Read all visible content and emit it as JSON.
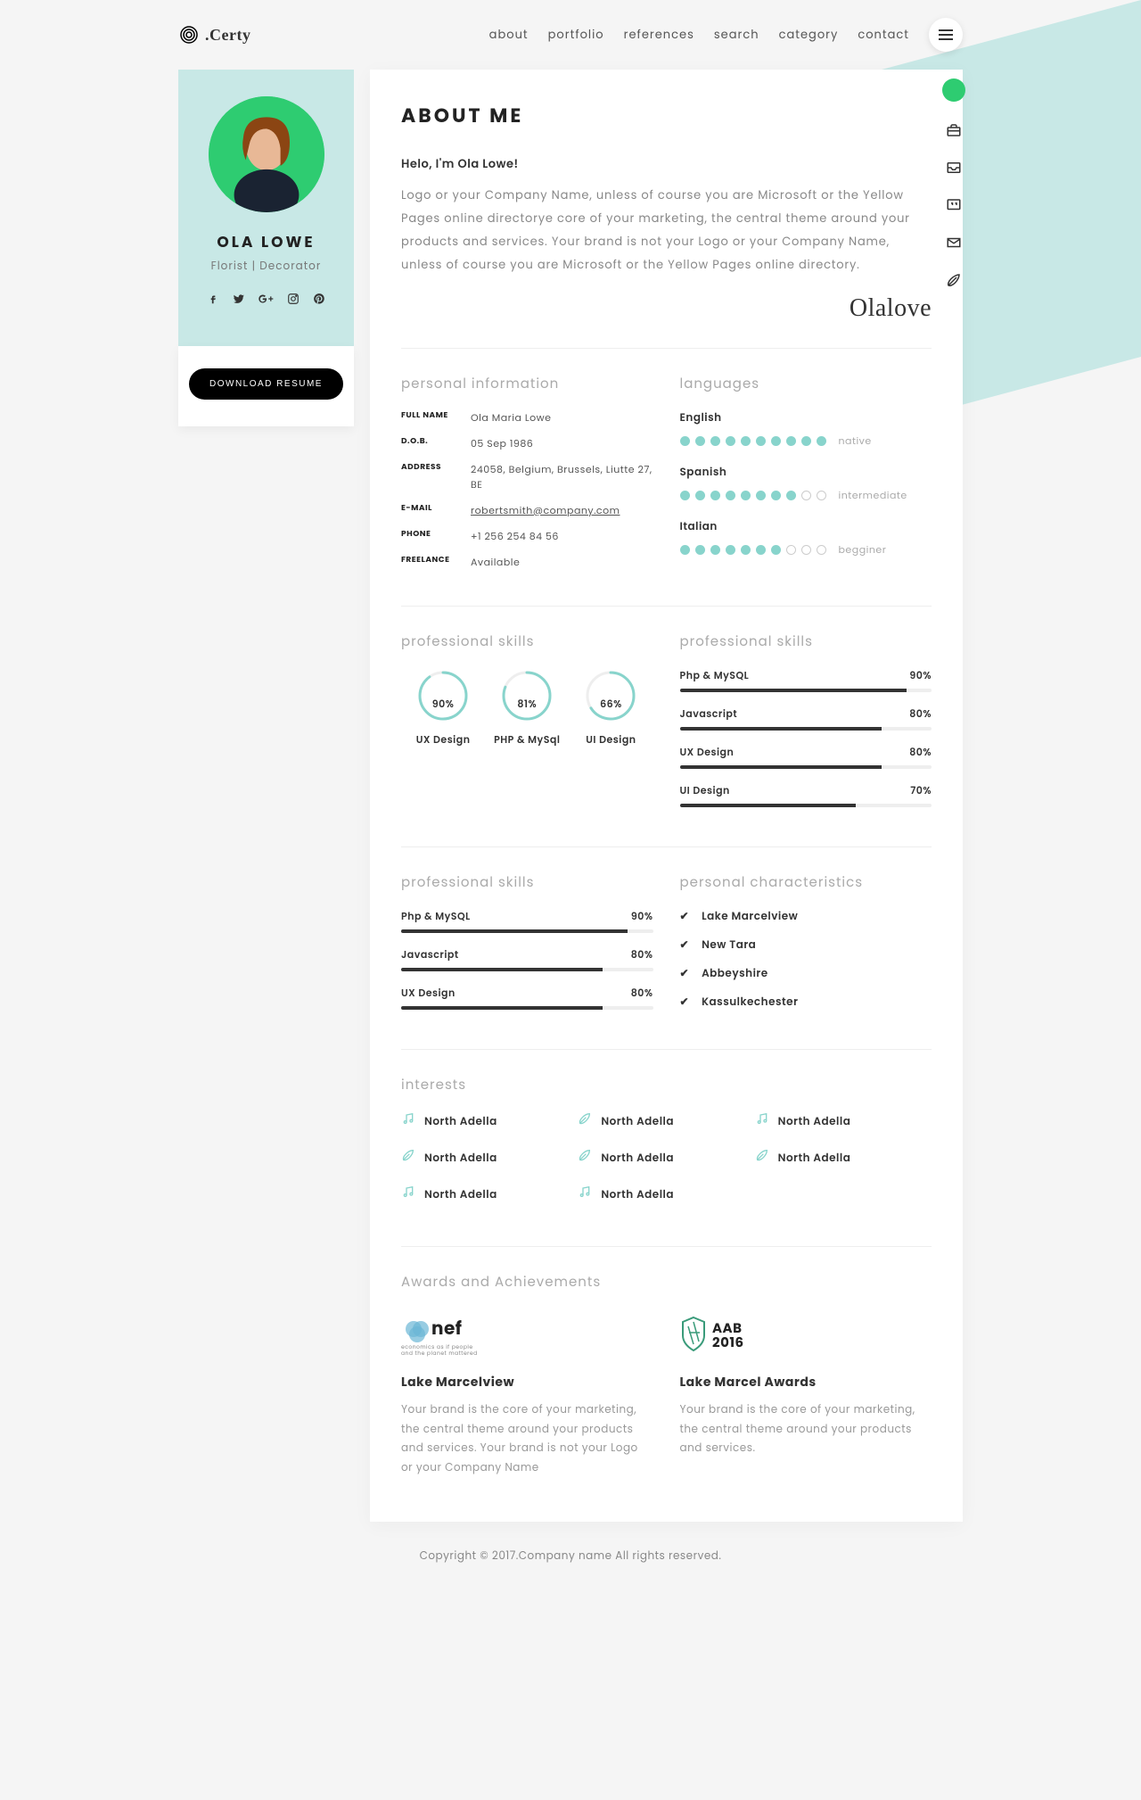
{
  "brand": ".Certy",
  "nav": [
    "about",
    "portfolio",
    "references",
    "search",
    "category",
    "contact"
  ],
  "profile": {
    "name": "OLA LOWE",
    "role": "Florist | Decorator",
    "download": "DOWNLOAD RESUME"
  },
  "about": {
    "heading": "ABOUT ME",
    "hello": "Helo, I'm Ola Lowe!",
    "text": "Logo or your Company Name, unless of course you are Microsoft or the Yellow Pages online directorye core of your marketing, the central theme around your products and services. Your brand is not your Logo or your Company Name, unless of course you are Microsoft or the Yellow Pages online directory.",
    "signature": "Olalove"
  },
  "sections": {
    "personal_info": "personal information",
    "languages": "languages",
    "pro_skills": "professional skills",
    "characteristics": "personal characteristics",
    "interests": "interests",
    "awards": "Awards and Achievements"
  },
  "info": {
    "full_name_l": "FULL NAME",
    "full_name": "Ola Maria Lowe",
    "dob_l": "D.O.B.",
    "dob": "05 Sep 1986",
    "address_l": "ADDRESS",
    "address": "24058, Belgium, Brussels, Liutte 27, BE",
    "email_l": "E-MAIL",
    "email": "robertsmith@company.com",
    "phone_l": "PHONE",
    "phone": "+1 256 254 84 56",
    "freelance_l": "FREELANCE",
    "freelance": "Available"
  },
  "languages": [
    {
      "name": "English",
      "level": "native",
      "filled": 10
    },
    {
      "name": "Spanish",
      "level": "intermediate",
      "filled": 8
    },
    {
      "name": "Italian",
      "level": "begginer",
      "filled": 7
    }
  ],
  "circle_skills": [
    {
      "label": "UX Design",
      "pct": 90
    },
    {
      "label": "PHP & MySql",
      "pct": 81
    },
    {
      "label": "UI Design",
      "pct": 66
    }
  ],
  "bar_skills_1": [
    {
      "name": "Php & MySQL",
      "pct": 90
    },
    {
      "name": "Javascript",
      "pct": 80
    },
    {
      "name": "UX Design",
      "pct": 80
    },
    {
      "name": "UI Design",
      "pct": 70
    }
  ],
  "bar_skills_2": [
    {
      "name": "Php & MySQL",
      "pct": 90
    },
    {
      "name": "Javascript",
      "pct": 80
    },
    {
      "name": "UX Design",
      "pct": 80
    }
  ],
  "characteristics": [
    "Lake Marcelview",
    "New Tara",
    "Abbeyshire",
    "Kassulkechester"
  ],
  "interests": [
    "North Adella",
    "North Adella",
    "North Adella",
    "North Adella",
    "North Adella",
    "North Adella",
    "North Adella",
    "North Adella"
  ],
  "interest_icons": [
    "music",
    "leaf",
    "music",
    "leaf",
    "leaf",
    "leaf",
    "music",
    "music"
  ],
  "awards": [
    {
      "logo": "nef",
      "title": "Lake Marcelview",
      "desc": "Your brand is the core of your marketing, the central theme around your products and services. Your brand is not your Logo or your Company Name"
    },
    {
      "logo": "AAB 2016",
      "title": "Lake Marcel Awards",
      "desc": "Your brand is the core of your marketing, the central theme around your products and services."
    }
  ],
  "footer": "Copyright © 2017.Company name All rights reserved."
}
